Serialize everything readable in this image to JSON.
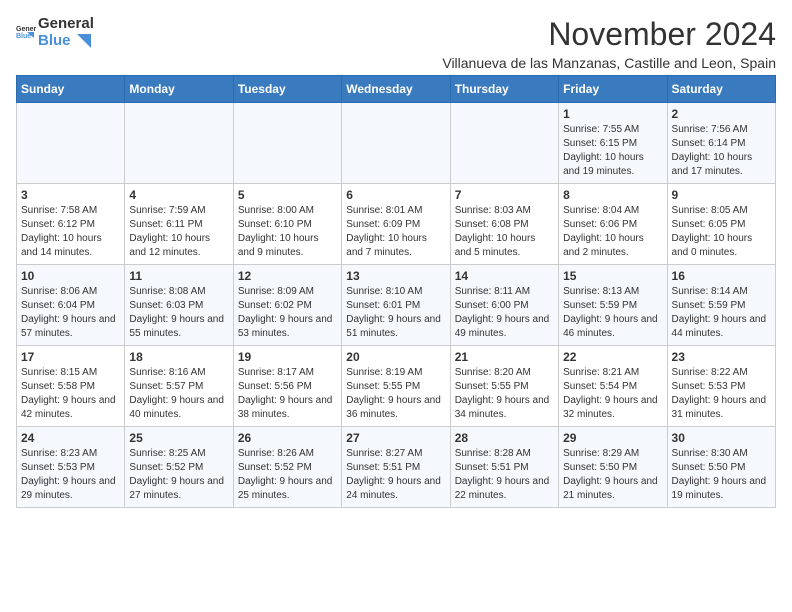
{
  "header": {
    "logo_general": "General",
    "logo_blue": "Blue",
    "title": "November 2024",
    "subtitle": "Villanueva de las Manzanas, Castille and Leon, Spain"
  },
  "weekdays": [
    "Sunday",
    "Monday",
    "Tuesday",
    "Wednesday",
    "Thursday",
    "Friday",
    "Saturday"
  ],
  "weeks": [
    [
      {
        "day": "",
        "info": ""
      },
      {
        "day": "",
        "info": ""
      },
      {
        "day": "",
        "info": ""
      },
      {
        "day": "",
        "info": ""
      },
      {
        "day": "",
        "info": ""
      },
      {
        "day": "1",
        "info": "Sunrise: 7:55 AM\nSunset: 6:15 PM\nDaylight: 10 hours and 19 minutes."
      },
      {
        "day": "2",
        "info": "Sunrise: 7:56 AM\nSunset: 6:14 PM\nDaylight: 10 hours and 17 minutes."
      }
    ],
    [
      {
        "day": "3",
        "info": "Sunrise: 7:58 AM\nSunset: 6:12 PM\nDaylight: 10 hours and 14 minutes."
      },
      {
        "day": "4",
        "info": "Sunrise: 7:59 AM\nSunset: 6:11 PM\nDaylight: 10 hours and 12 minutes."
      },
      {
        "day": "5",
        "info": "Sunrise: 8:00 AM\nSunset: 6:10 PM\nDaylight: 10 hours and 9 minutes."
      },
      {
        "day": "6",
        "info": "Sunrise: 8:01 AM\nSunset: 6:09 PM\nDaylight: 10 hours and 7 minutes."
      },
      {
        "day": "7",
        "info": "Sunrise: 8:03 AM\nSunset: 6:08 PM\nDaylight: 10 hours and 5 minutes."
      },
      {
        "day": "8",
        "info": "Sunrise: 8:04 AM\nSunset: 6:06 PM\nDaylight: 10 hours and 2 minutes."
      },
      {
        "day": "9",
        "info": "Sunrise: 8:05 AM\nSunset: 6:05 PM\nDaylight: 10 hours and 0 minutes."
      }
    ],
    [
      {
        "day": "10",
        "info": "Sunrise: 8:06 AM\nSunset: 6:04 PM\nDaylight: 9 hours and 57 minutes."
      },
      {
        "day": "11",
        "info": "Sunrise: 8:08 AM\nSunset: 6:03 PM\nDaylight: 9 hours and 55 minutes."
      },
      {
        "day": "12",
        "info": "Sunrise: 8:09 AM\nSunset: 6:02 PM\nDaylight: 9 hours and 53 minutes."
      },
      {
        "day": "13",
        "info": "Sunrise: 8:10 AM\nSunset: 6:01 PM\nDaylight: 9 hours and 51 minutes."
      },
      {
        "day": "14",
        "info": "Sunrise: 8:11 AM\nSunset: 6:00 PM\nDaylight: 9 hours and 49 minutes."
      },
      {
        "day": "15",
        "info": "Sunrise: 8:13 AM\nSunset: 5:59 PM\nDaylight: 9 hours and 46 minutes."
      },
      {
        "day": "16",
        "info": "Sunrise: 8:14 AM\nSunset: 5:59 PM\nDaylight: 9 hours and 44 minutes."
      }
    ],
    [
      {
        "day": "17",
        "info": "Sunrise: 8:15 AM\nSunset: 5:58 PM\nDaylight: 9 hours and 42 minutes."
      },
      {
        "day": "18",
        "info": "Sunrise: 8:16 AM\nSunset: 5:57 PM\nDaylight: 9 hours and 40 minutes."
      },
      {
        "day": "19",
        "info": "Sunrise: 8:17 AM\nSunset: 5:56 PM\nDaylight: 9 hours and 38 minutes."
      },
      {
        "day": "20",
        "info": "Sunrise: 8:19 AM\nSunset: 5:55 PM\nDaylight: 9 hours and 36 minutes."
      },
      {
        "day": "21",
        "info": "Sunrise: 8:20 AM\nSunset: 5:55 PM\nDaylight: 9 hours and 34 minutes."
      },
      {
        "day": "22",
        "info": "Sunrise: 8:21 AM\nSunset: 5:54 PM\nDaylight: 9 hours and 32 minutes."
      },
      {
        "day": "23",
        "info": "Sunrise: 8:22 AM\nSunset: 5:53 PM\nDaylight: 9 hours and 31 minutes."
      }
    ],
    [
      {
        "day": "24",
        "info": "Sunrise: 8:23 AM\nSunset: 5:53 PM\nDaylight: 9 hours and 29 minutes."
      },
      {
        "day": "25",
        "info": "Sunrise: 8:25 AM\nSunset: 5:52 PM\nDaylight: 9 hours and 27 minutes."
      },
      {
        "day": "26",
        "info": "Sunrise: 8:26 AM\nSunset: 5:52 PM\nDaylight: 9 hours and 25 minutes."
      },
      {
        "day": "27",
        "info": "Sunrise: 8:27 AM\nSunset: 5:51 PM\nDaylight: 9 hours and 24 minutes."
      },
      {
        "day": "28",
        "info": "Sunrise: 8:28 AM\nSunset: 5:51 PM\nDaylight: 9 hours and 22 minutes."
      },
      {
        "day": "29",
        "info": "Sunrise: 8:29 AM\nSunset: 5:50 PM\nDaylight: 9 hours and 21 minutes."
      },
      {
        "day": "30",
        "info": "Sunrise: 8:30 AM\nSunset: 5:50 PM\nDaylight: 9 hours and 19 minutes."
      }
    ]
  ]
}
